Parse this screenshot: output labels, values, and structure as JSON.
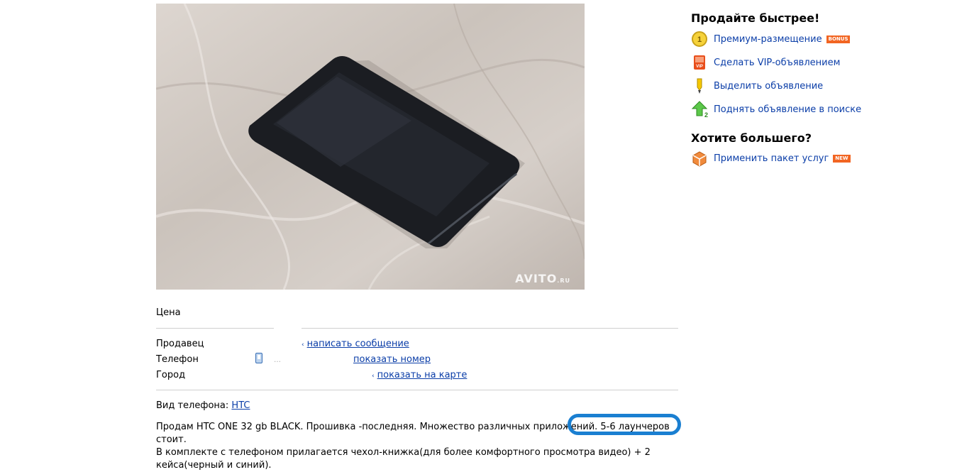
{
  "photo": {
    "watermark": "AVITO",
    "watermark_suffix": ".RU"
  },
  "details": {
    "price_label": "Цена",
    "seller_label": "Продавец",
    "seller_link": "написать сообщение",
    "phone_label": "Телефон",
    "phone_value": "…",
    "phone_link": "показать номер",
    "city_label": "Город",
    "city_link": "показать на карте",
    "type_label": "Вид телефона:",
    "type_value": "HTC",
    "description_1": "Продам HTC ONE 32 gb BLACK. Прошивка -последняя. Множество различных приложений. 5-6 лаунчеров стоит.",
    "description_2": "В комплекте с телефоном прилагается чехол-книжка(для более комфортного просмотра видео) + 2",
    "description_3": "кейса(черный и синий)."
  },
  "sidebar": {
    "sell_faster_title": "Продайте быстрее!",
    "items": [
      {
        "label": "Премиум-размещение",
        "icon": "coin-icon",
        "badge": "BONUS"
      },
      {
        "label": "Сделать VIP-объявлением",
        "icon": "vip-icon",
        "badge": ""
      },
      {
        "label": "Выделить объявление",
        "icon": "marker-icon",
        "badge": ""
      },
      {
        "label": "Поднять объявление в поиске",
        "icon": "arrow-up-icon",
        "badge": ""
      }
    ],
    "want_more_title": "Хотите большего?",
    "package": {
      "label": "Применить пакет услуг",
      "icon": "package-icon",
      "badge": "NEW"
    },
    "coin_digit": "1",
    "vip_text": "VIP",
    "lift_digit": "2"
  },
  "colors": {
    "link": "#0b3ea8",
    "badge_orange": "#f26522",
    "highlight_blue": "#1a7fd1"
  }
}
